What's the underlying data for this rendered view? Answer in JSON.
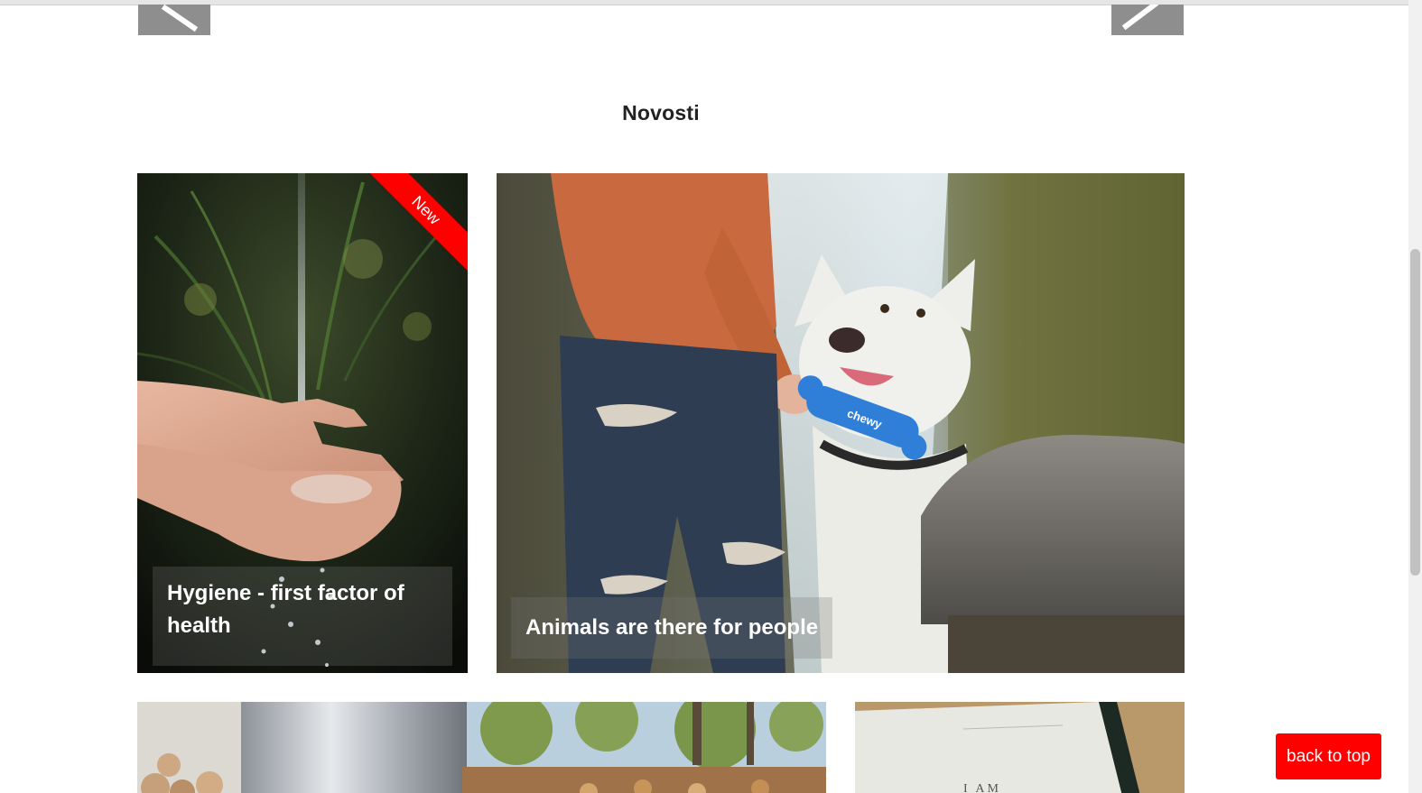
{
  "section": {
    "title": "Novosti"
  },
  "nav": {
    "prev_icon": "chevron-left-icon",
    "next_icon": "chevron-right-icon"
  },
  "cards": [
    {
      "title_lines": [
        "Hygiene - first factor of",
        "health"
      ],
      "badge": "New",
      "image": "hands-water-image"
    },
    {
      "title_lines": [
        "Animals are there for people"
      ],
      "badge": "",
      "image": "dog-toy-image",
      "toy_text": "chewy"
    },
    {
      "title_lines": [],
      "image": "firewood-silo-image"
    },
    {
      "title_lines": [],
      "image": "open-book-image",
      "book_text": "I AM"
    }
  ],
  "back_to_top": {
    "label": "back to top"
  },
  "colors": {
    "accent": "#ff0000",
    "nav_arrow_bg": "#8e8e8e",
    "title_text": "#222222"
  }
}
